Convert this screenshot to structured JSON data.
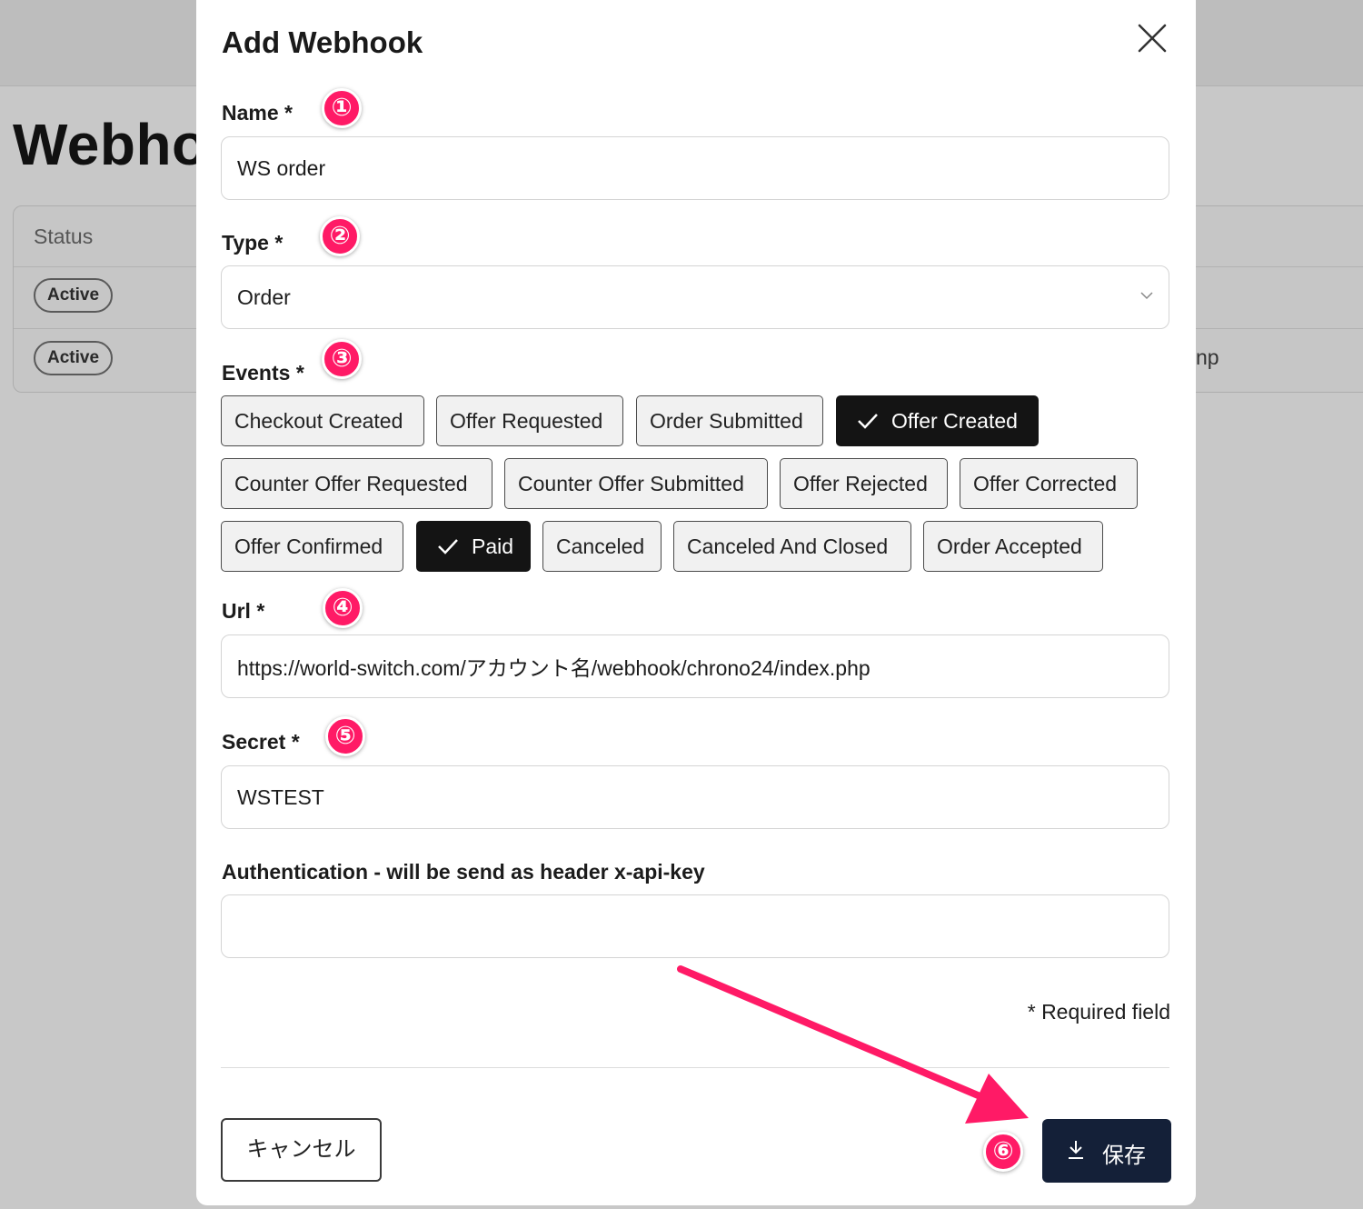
{
  "background": {
    "page_title": "Webho",
    "table": {
      "status_header": "Status",
      "rows": [
        {
          "status": "Active"
        },
        {
          "status": "Active",
          "url_fragment": "np"
        }
      ]
    }
  },
  "modal": {
    "title": "Add Webhook",
    "fields": {
      "name": {
        "label": "Name *",
        "value": "WS order"
      },
      "type": {
        "label": "Type *",
        "value": "Order"
      },
      "events": {
        "label": "Events *"
      },
      "url": {
        "label": "Url *",
        "value": "https://world-switch.com/アカウント名/webhook/chrono24/index.php"
      },
      "secret": {
        "label": "Secret *",
        "value": "WSTEST"
      },
      "authentication": {
        "label": "Authentication - will be send as header x-api-key",
        "value": ""
      }
    },
    "events": [
      {
        "label": "Checkout Created",
        "selected": false
      },
      {
        "label": "Offer Requested",
        "selected": false
      },
      {
        "label": "Order Submitted",
        "selected": false
      },
      {
        "label": "Offer Created",
        "selected": true
      },
      {
        "label": "Counter Offer Requested",
        "selected": false
      },
      {
        "label": "Counter Offer Submitted",
        "selected": false
      },
      {
        "label": "Offer Rejected",
        "selected": false
      },
      {
        "label": "Offer Corrected",
        "selected": false
      },
      {
        "label": "Offer Confirmed",
        "selected": false
      },
      {
        "label": "Paid",
        "selected": true
      },
      {
        "label": "Canceled",
        "selected": false
      },
      {
        "label": "Canceled And Closed",
        "selected": false
      },
      {
        "label": "Order Accepted",
        "selected": false
      }
    ],
    "required_note": "* Required field",
    "cancel_label": "キャンセル",
    "save_label": "保存"
  },
  "annotations": [
    "①",
    "②",
    "③",
    "④",
    "⑤",
    "⑥"
  ],
  "colors": {
    "annotation": "#ff1a66",
    "save_button": "#142038",
    "selected_chip": "#141414"
  }
}
